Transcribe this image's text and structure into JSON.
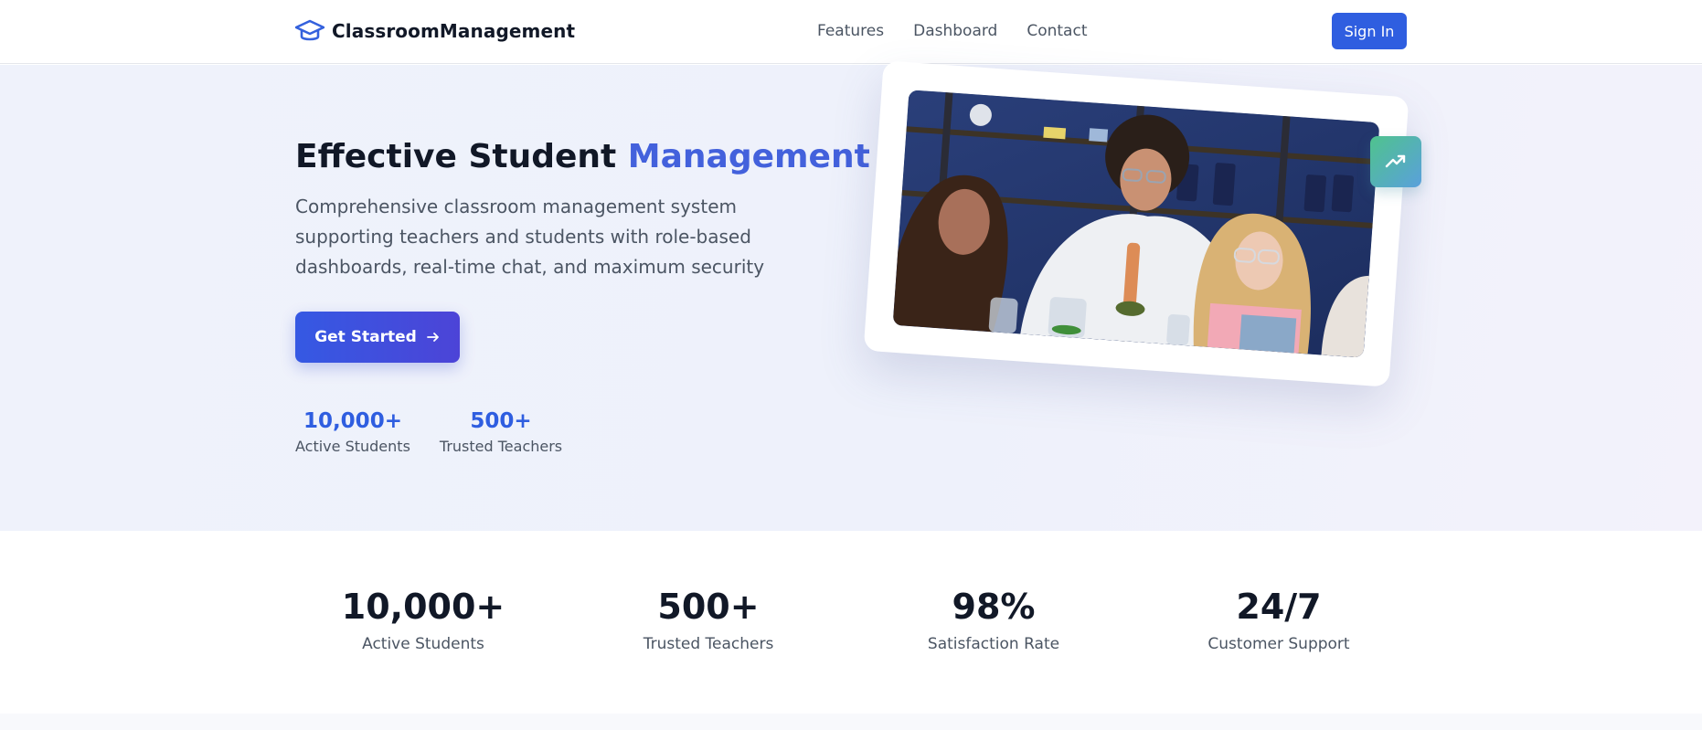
{
  "nav": {
    "brand": "ClassroomManagement",
    "links": [
      "Features",
      "Dashboard",
      "Contact"
    ],
    "sign_in": "Sign In"
  },
  "hero": {
    "title_main": "Effective Student ",
    "title_accent": "Management",
    "subtitle": "Comprehensive classroom management system supporting teachers and students with role-based dashboards, real-time chat, and maximum security",
    "cta": "Get Started",
    "mini_stats": [
      {
        "value": "10,000+",
        "label": "Active Students"
      },
      {
        "value": "500+",
        "label": "Trusted Teachers"
      }
    ]
  },
  "stats": [
    {
      "value": "10,000+",
      "label": "Active Students"
    },
    {
      "value": "500+",
      "label": "Trusted Teachers"
    },
    {
      "value": "98%",
      "label": "Satisfaction Rate"
    },
    {
      "value": "24/7",
      "label": "Customer Support"
    }
  ],
  "icons": {
    "brand": "graduation-cap-icon",
    "cta": "arrow-right-icon",
    "badge": "trending-up-icon"
  },
  "colors": {
    "primary": "#2f5ee0",
    "accent": "#4361dc",
    "badge_from": "#4fc38d",
    "badge_to": "#5aa0dc"
  }
}
